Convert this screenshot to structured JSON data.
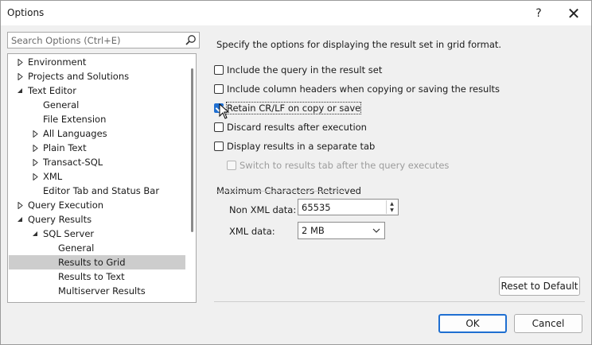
{
  "window": {
    "title": "Options",
    "help_glyph": "?",
    "close_glyph": "✕"
  },
  "search": {
    "placeholder": "Search Options (Ctrl+E)"
  },
  "tree": {
    "items": [
      {
        "label": "Environment",
        "expander": "collapsed",
        "level": 0
      },
      {
        "label": "Projects and Solutions",
        "expander": "collapsed",
        "level": 0
      },
      {
        "label": "Text Editor",
        "expander": "expanded",
        "level": 0
      },
      {
        "label": "General",
        "expander": "none",
        "level": 1
      },
      {
        "label": "File Extension",
        "expander": "none",
        "level": 1
      },
      {
        "label": "All Languages",
        "expander": "collapsed",
        "level": 1
      },
      {
        "label": "Plain Text",
        "expander": "collapsed",
        "level": 1
      },
      {
        "label": "Transact-SQL",
        "expander": "collapsed",
        "level": 1
      },
      {
        "label": "XML",
        "expander": "collapsed",
        "level": 1
      },
      {
        "label": "Editor Tab and Status Bar",
        "expander": "none",
        "level": 1
      },
      {
        "label": "Query Execution",
        "expander": "collapsed",
        "level": 0
      },
      {
        "label": "Query Results",
        "expander": "expanded",
        "level": 0
      },
      {
        "label": "SQL Server",
        "expander": "expanded",
        "level": 1
      },
      {
        "label": "General",
        "expander": "none",
        "level": 2
      },
      {
        "label": "Results to Grid",
        "expander": "none",
        "level": 2,
        "selected": true
      },
      {
        "label": "Results to Text",
        "expander": "none",
        "level": 2
      },
      {
        "label": "Multiserver Results",
        "expander": "none",
        "level": 2
      }
    ]
  },
  "panel": {
    "description": "Specify the options for displaying the result set in grid format.",
    "options": [
      {
        "label": "Include the query in the result set",
        "checked": false,
        "enabled": true
      },
      {
        "label": "Include column headers when copying or saving the results",
        "checked": false,
        "enabled": true
      },
      {
        "label": "Retain CR/LF on copy or save",
        "checked": true,
        "enabled": true,
        "focused": true
      },
      {
        "label": "Discard results after execution",
        "checked": false,
        "enabled": true
      },
      {
        "label": "Display results in a separate tab",
        "checked": false,
        "enabled": true
      },
      {
        "label": "Switch to results tab after the query executes",
        "checked": false,
        "enabled": false
      }
    ],
    "max_chars": {
      "group_title": "Maximum Characters Retrieved",
      "non_xml_label": "Non XML data:",
      "non_xml_value": "65535",
      "xml_label": "XML data:",
      "xml_value": "2 MB"
    },
    "reset_label": "Reset to Default"
  },
  "footer": {
    "ok_label": "OK",
    "cancel_label": "Cancel"
  },
  "colors": {
    "accent": "#1f6fd1",
    "selection": "#cdcdcd"
  }
}
